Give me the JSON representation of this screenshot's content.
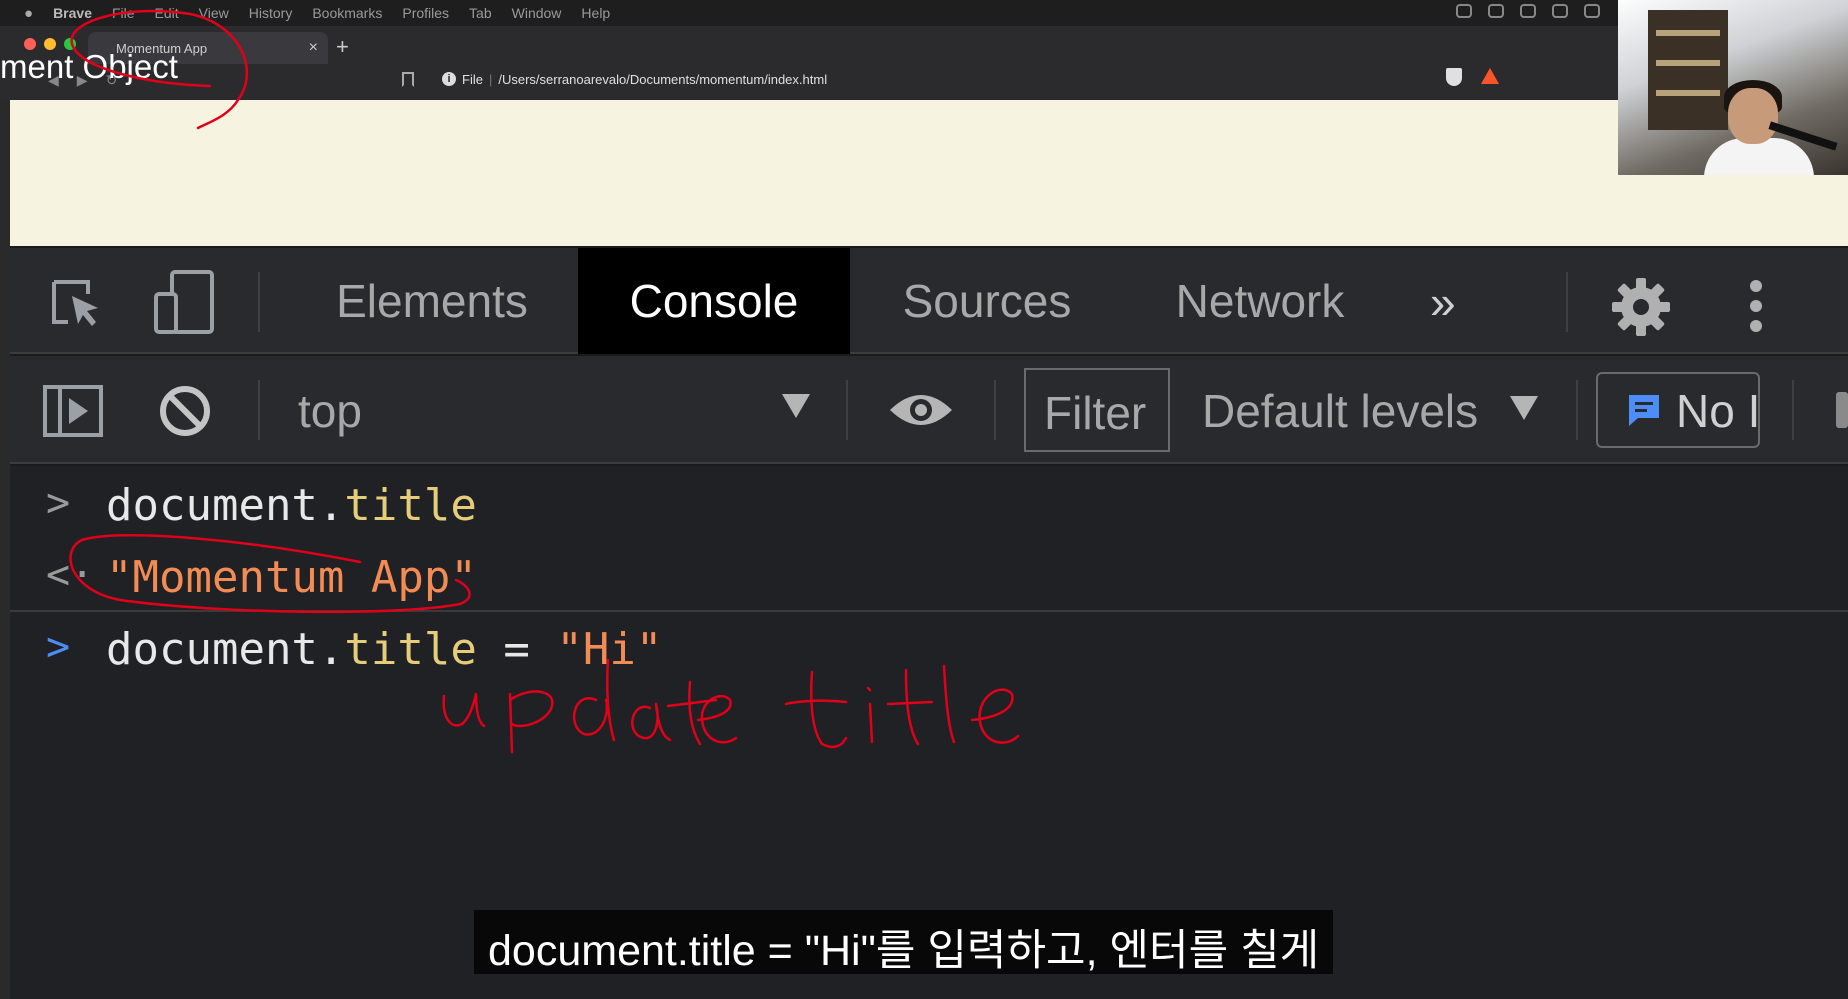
{
  "menubar": {
    "app_name": "Brave",
    "items": [
      "File",
      "Edit",
      "View",
      "History",
      "Bookmarks",
      "Profiles",
      "Tab",
      "Window",
      "Help"
    ]
  },
  "slide": {
    "title_fragment": "ment Object"
  },
  "browser": {
    "tab_title": "Momentum App",
    "tab_close": "×",
    "new_tab": "+",
    "url_scheme": "File",
    "url_path": "/Users/serranoarevalo/Documents/momentum/index.html"
  },
  "devtools": {
    "tabs": [
      "Elements",
      "Console",
      "Sources",
      "Network"
    ],
    "active_tab": "Console",
    "more_tabs": "»",
    "toolbar": {
      "context": "top",
      "filter_placeholder": "Filter",
      "levels": "Default levels",
      "issues": "No I"
    }
  },
  "console": {
    "entries": [
      {
        "kind": "input",
        "object": "document",
        "dot": ".",
        "property": "title"
      },
      {
        "kind": "result",
        "value": "\"Momentum App\""
      },
      {
        "kind": "input",
        "object": "document",
        "dot": ".",
        "property": "title",
        "operator": " = ",
        "value": "\"Hi\""
      }
    ]
  },
  "annotation": {
    "handwritten": "update title",
    "ink_color": "#e0001a"
  },
  "subtitle": {
    "text": "document.title = \"Hi\"를 입력하고, 엔터를 칠게"
  },
  "colors": {
    "devtools_bg": "#292a2d",
    "console_bg": "#202124",
    "active_tab_bg": "#000000",
    "property": "#e6cd7a",
    "string": "#f28b54",
    "prompt_active": "#4c8df6",
    "page_bg": "#f6f4e1"
  }
}
